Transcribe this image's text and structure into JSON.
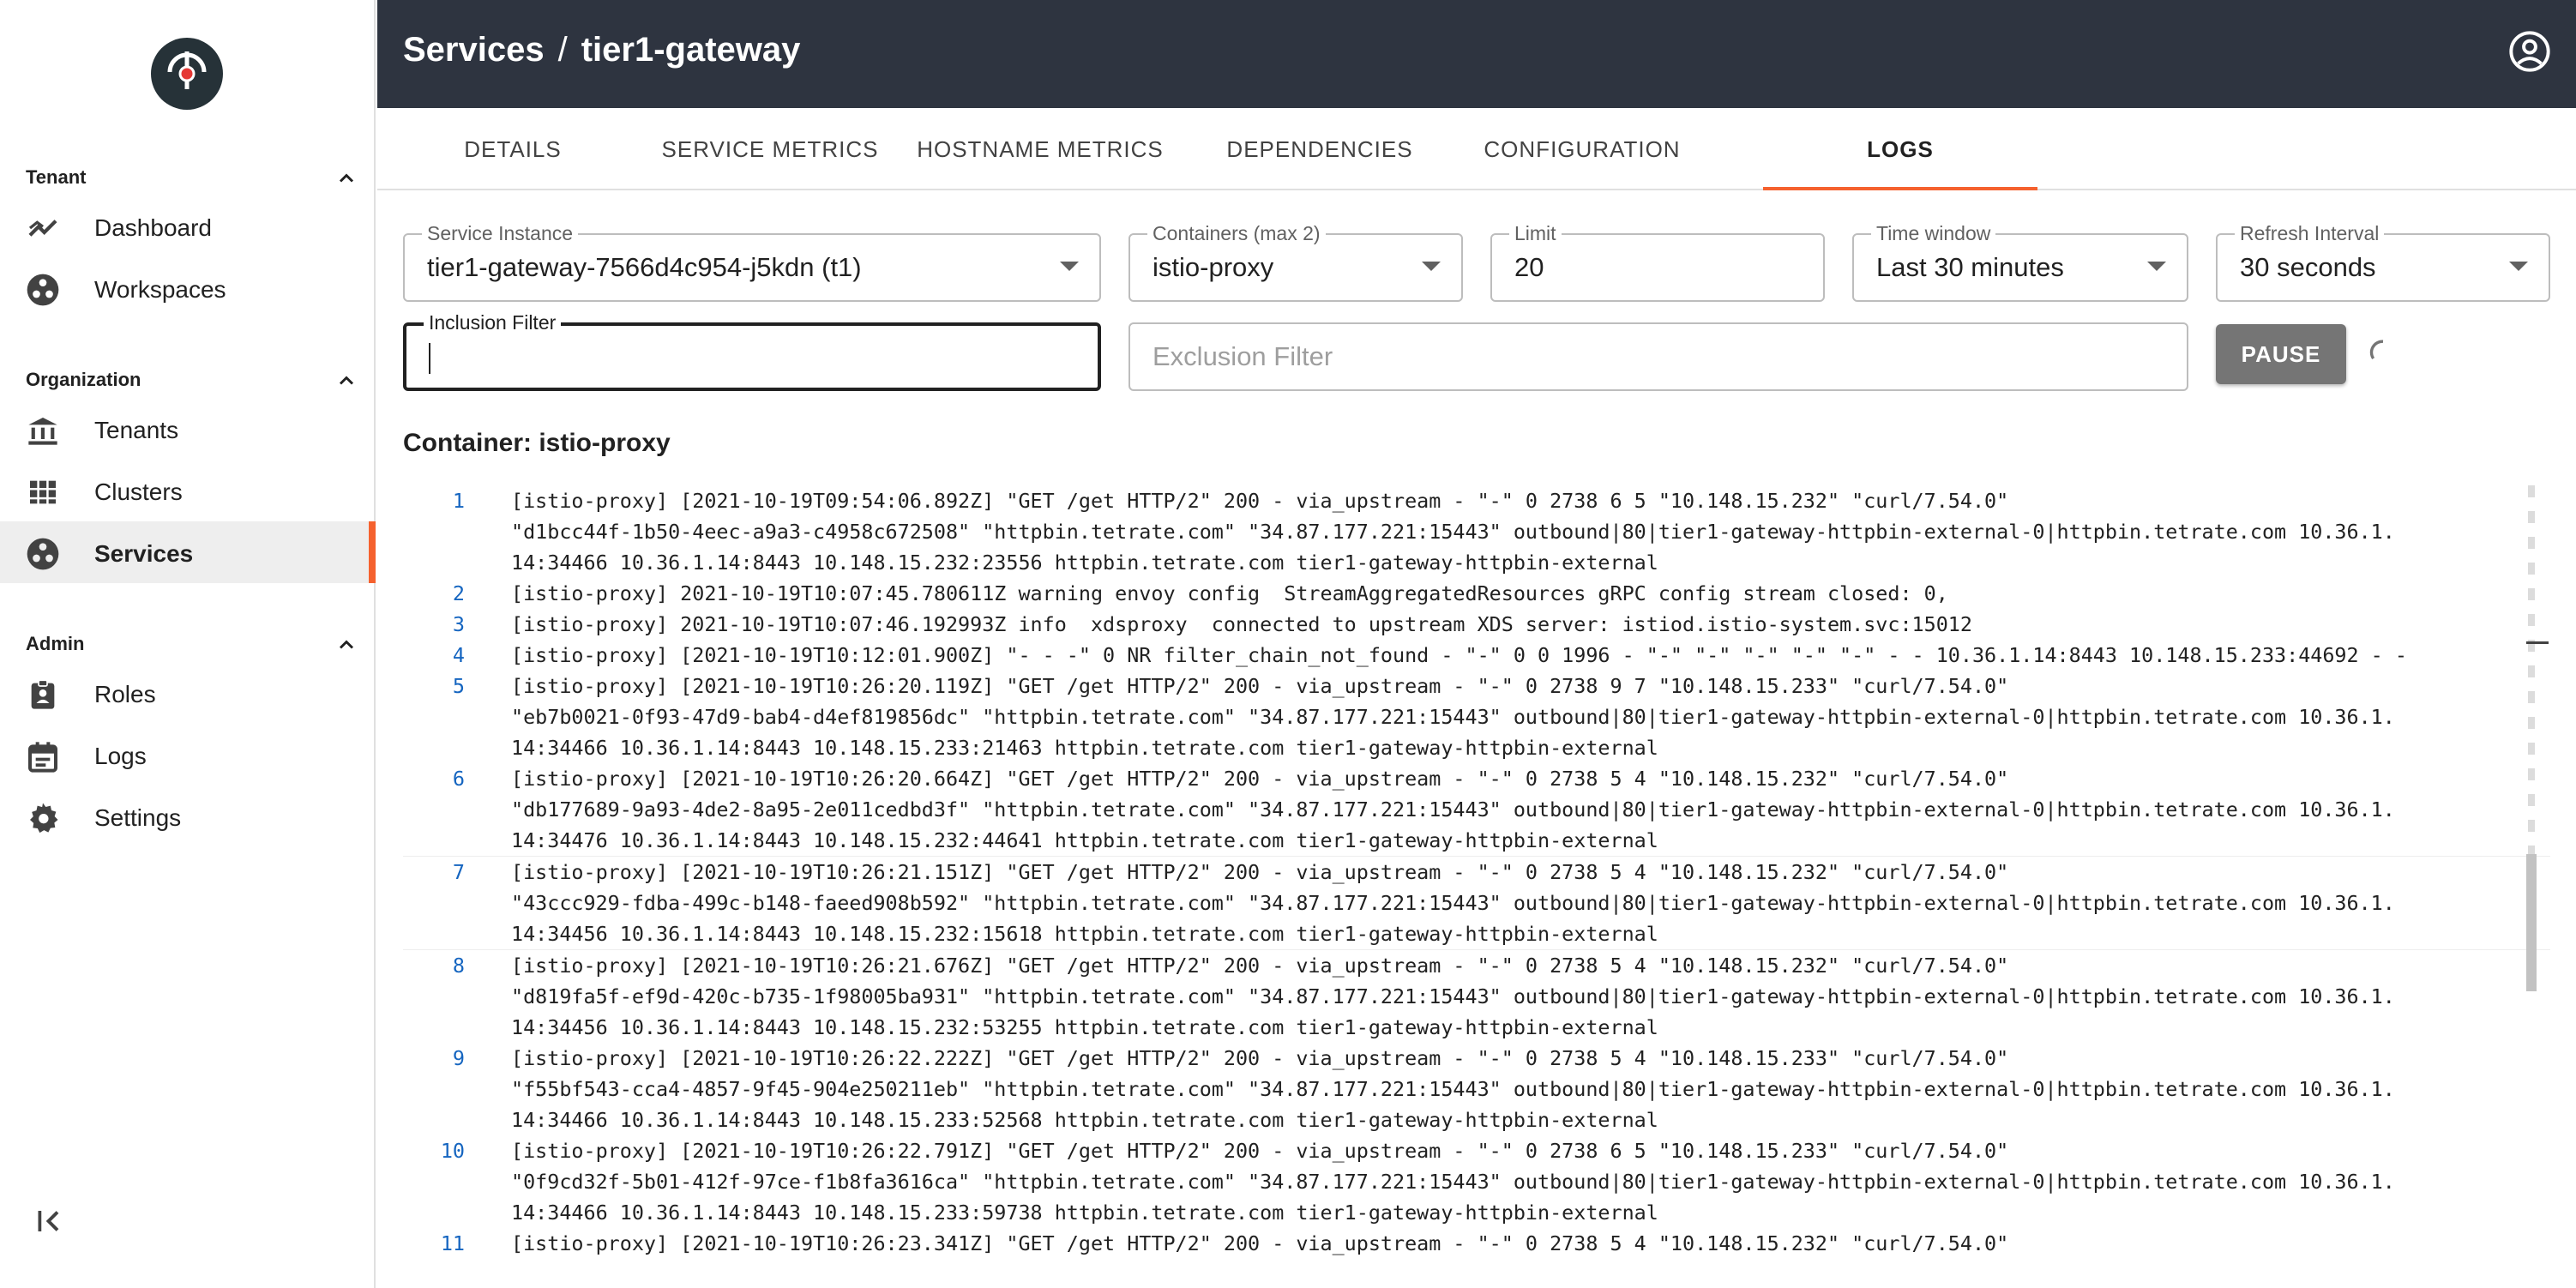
{
  "sidebar": {
    "sections": [
      {
        "title": "Tenant",
        "items": [
          {
            "label": "Dashboard",
            "icon": "dashboard-trend-icon"
          },
          {
            "label": "Workspaces",
            "icon": "workspaces-icon"
          }
        ]
      },
      {
        "title": "Organization",
        "items": [
          {
            "label": "Tenants",
            "icon": "bank-icon"
          },
          {
            "label": "Clusters",
            "icon": "grid-icon"
          },
          {
            "label": "Services",
            "icon": "services-icon",
            "active": true
          }
        ]
      },
      {
        "title": "Admin",
        "items": [
          {
            "label": "Roles",
            "icon": "badge-icon"
          },
          {
            "label": "Logs",
            "icon": "calendar-icon"
          },
          {
            "label": "Settings",
            "icon": "gear-icon"
          }
        ]
      }
    ],
    "accent_color": "#f5612e"
  },
  "header": {
    "breadcrumb_root": "Services",
    "breadcrumb_separator": "/",
    "breadcrumb_current": "tier1-gateway",
    "background": "#2e3440"
  },
  "tabs": [
    {
      "label": "DETAILS"
    },
    {
      "label": "SERVICE METRICS"
    },
    {
      "label": "HOSTNAME METRICS"
    },
    {
      "label": "DEPENDENCIES"
    },
    {
      "label": "CONFIGURATION"
    },
    {
      "label": "LOGS",
      "active": true
    }
  ],
  "filters": {
    "service_instance": {
      "label": "Service Instance",
      "value": "tier1-gateway-7566d4c954-j5kdn (t1)"
    },
    "containers": {
      "label": "Containers (max 2)",
      "value": "istio-proxy"
    },
    "limit": {
      "label": "Limit",
      "value": "20"
    },
    "time_window": {
      "label": "Time window",
      "value": "Last 30 minutes"
    },
    "refresh_interval": {
      "label": "Refresh Interval",
      "value": "30 seconds"
    },
    "inclusion_filter": {
      "label": "Inclusion Filter",
      "value": ""
    },
    "exclusion_filter": {
      "placeholder": "Exclusion Filter",
      "value": ""
    },
    "pause_label": "PAUSE"
  },
  "container_heading": "Container: istio-proxy",
  "logs": [
    {
      "num": "1",
      "lines": [
        "[istio-proxy] [2021-10-19T09:54:06.892Z] \"GET /get HTTP/2\" 200 - via_upstream - \"-\" 0 2738 6 5 \"10.148.15.232\" \"curl/7.54.0\"",
        "\"d1bcc44f-1b50-4eec-a9a3-c4958c672508\" \"httpbin.tetrate.com\" \"34.87.177.221:15443\" outbound|80|tier1-gateway-httpbin-external-0|httpbin.tetrate.com 10.36.1.",
        "14:34466 10.36.1.14:8443 10.148.15.232:23556 httpbin.tetrate.com tier1-gateway-httpbin-external"
      ]
    },
    {
      "num": "2",
      "lines": [
        "[istio-proxy] 2021-10-19T10:07:45.780611Z warning envoy config  StreamAggregatedResources gRPC config stream closed: 0,"
      ]
    },
    {
      "num": "3",
      "lines": [
        "[istio-proxy] 2021-10-19T10:07:46.192993Z info  xdsproxy  connected to upstream XDS server: istiod.istio-system.svc:15012"
      ]
    },
    {
      "num": "4",
      "lines": [
        "[istio-proxy] [2021-10-19T10:12:01.900Z] \"- - -\" 0 NR filter_chain_not_found - \"-\" 0 0 1996 - \"-\" \"-\" \"-\" \"-\" \"-\" - - 10.36.1.14:8443 10.148.15.233:44692 - -"
      ]
    },
    {
      "num": "5",
      "lines": [
        "[istio-proxy] [2021-10-19T10:26:20.119Z] \"GET /get HTTP/2\" 200 - via_upstream - \"-\" 0 2738 9 7 \"10.148.15.233\" \"curl/7.54.0\"",
        "\"eb7b0021-0f93-47d9-bab4-d4ef819856dc\" \"httpbin.tetrate.com\" \"34.87.177.221:15443\" outbound|80|tier1-gateway-httpbin-external-0|httpbin.tetrate.com 10.36.1.",
        "14:34466 10.36.1.14:8443 10.148.15.233:21463 httpbin.tetrate.com tier1-gateway-httpbin-external"
      ]
    },
    {
      "num": "6",
      "lines": [
        "[istio-proxy] [2021-10-19T10:26:20.664Z] \"GET /get HTTP/2\" 200 - via_upstream - \"-\" 0 2738 5 4 \"10.148.15.232\" \"curl/7.54.0\"",
        "\"db177689-9a93-4de2-8a95-2e011cedbd3f\" \"httpbin.tetrate.com\" \"34.87.177.221:15443\" outbound|80|tier1-gateway-httpbin-external-0|httpbin.tetrate.com 10.36.1.",
        "14:34476 10.36.1.14:8443 10.148.15.232:44641 httpbin.tetrate.com tier1-gateway-httpbin-external"
      ]
    },
    {
      "num": "7",
      "lines": [
        "[istio-proxy] [2021-10-19T10:26:21.151Z] \"GET /get HTTP/2\" 200 - via_upstream - \"-\" 0 2738 5 4 \"10.148.15.232\" \"curl/7.54.0\"",
        "\"43ccc929-fdba-499c-b148-faeed908b592\" \"httpbin.tetrate.com\" \"34.87.177.221:15443\" outbound|80|tier1-gateway-httpbin-external-0|httpbin.tetrate.com 10.36.1.",
        "14:34456 10.36.1.14:8443 10.148.15.232:15618 httpbin.tetrate.com tier1-gateway-httpbin-external"
      ]
    },
    {
      "num": "8",
      "lines": [
        "[istio-proxy] [2021-10-19T10:26:21.676Z] \"GET /get HTTP/2\" 200 - via_upstream - \"-\" 0 2738 5 4 \"10.148.15.232\" \"curl/7.54.0\"",
        "\"d819fa5f-ef9d-420c-b735-1f98005ba931\" \"httpbin.tetrate.com\" \"34.87.177.221:15443\" outbound|80|tier1-gateway-httpbin-external-0|httpbin.tetrate.com 10.36.1.",
        "14:34456 10.36.1.14:8443 10.148.15.232:53255 httpbin.tetrate.com tier1-gateway-httpbin-external"
      ]
    },
    {
      "num": "9",
      "lines": [
        "[istio-proxy] [2021-10-19T10:26:22.222Z] \"GET /get HTTP/2\" 200 - via_upstream - \"-\" 0 2738 5 4 \"10.148.15.233\" \"curl/7.54.0\"",
        "\"f55bf543-cca4-4857-9f45-904e250211eb\" \"httpbin.tetrate.com\" \"34.87.177.221:15443\" outbound|80|tier1-gateway-httpbin-external-0|httpbin.tetrate.com 10.36.1.",
        "14:34466 10.36.1.14:8443 10.148.15.233:52568 httpbin.tetrate.com tier1-gateway-httpbin-external"
      ]
    },
    {
      "num": "10",
      "lines": [
        "[istio-proxy] [2021-10-19T10:26:22.791Z] \"GET /get HTTP/2\" 200 - via_upstream - \"-\" 0 2738 6 5 \"10.148.15.233\" \"curl/7.54.0\"",
        "\"0f9cd32f-5b01-412f-97ce-f1b8fa3616ca\" \"httpbin.tetrate.com\" \"34.87.177.221:15443\" outbound|80|tier1-gateway-httpbin-external-0|httpbin.tetrate.com 10.36.1.",
        "14:34466 10.36.1.14:8443 10.148.15.233:59738 httpbin.tetrate.com tier1-gateway-httpbin-external"
      ]
    },
    {
      "num": "11",
      "lines": [
        "[istio-proxy] [2021-10-19T10:26:23.341Z] \"GET /get HTTP/2\" 200 - via_upstream - \"-\" 0 2738 5 4 \"10.148.15.232\" \"curl/7.54.0\""
      ]
    }
  ]
}
